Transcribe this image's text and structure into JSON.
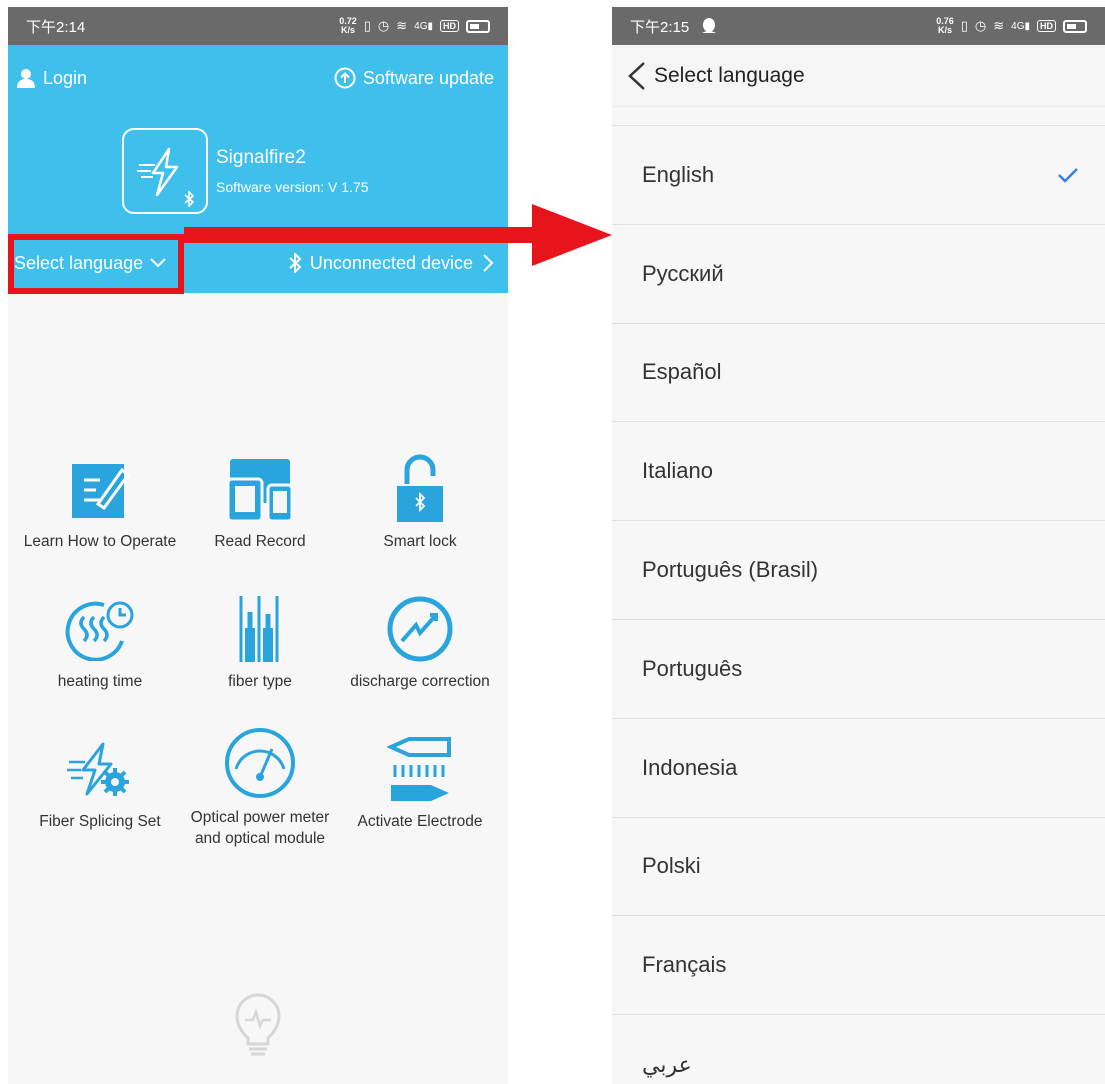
{
  "left_screen": {
    "status": {
      "time": "下午2:14",
      "speed_top": "0.72",
      "speed_bottom": "K/s",
      "network": "4G",
      "hd": "HD"
    },
    "header": {
      "login_label": "Login",
      "update_label": "Software update",
      "app_name": "Signalfire2",
      "app_version": "Software version: V 1.75",
      "select_language_label": "Select language",
      "device_label": "Unconnected device"
    },
    "menu": [
      {
        "label": "Learn How to Operate",
        "icon": "edit-document-icon"
      },
      {
        "label": "Read Record",
        "icon": "devices-icon"
      },
      {
        "label": "Smart lock",
        "icon": "lock-bluetooth-icon"
      },
      {
        "label": "heating time",
        "icon": "heating-timer-icon"
      },
      {
        "label": "fiber type",
        "icon": "fiber-type-icon"
      },
      {
        "label": "discharge correction",
        "icon": "discharge-icon"
      },
      {
        "label": "Fiber Splicing Set",
        "icon": "splicing-gear-icon"
      },
      {
        "label": "Optical power meter and optical module",
        "icon": "gauge-icon"
      },
      {
        "label": "Activate Electrode",
        "icon": "electrode-icon"
      }
    ]
  },
  "right_screen": {
    "status": {
      "time": "下午2:15",
      "speed_top": "0.76",
      "speed_bottom": "K/s",
      "network": "4G",
      "hd": "HD"
    },
    "title": "Select language",
    "languages": [
      {
        "label": "English",
        "selected": true
      },
      {
        "label": "Русский",
        "selected": false
      },
      {
        "label": "Español",
        "selected": false
      },
      {
        "label": "Italiano",
        "selected": false
      },
      {
        "label": "Português (Brasil)",
        "selected": false
      },
      {
        "label": "Português",
        "selected": false
      },
      {
        "label": "Indonesia",
        "selected": false
      },
      {
        "label": "Polski",
        "selected": false
      },
      {
        "label": "Français",
        "selected": false
      },
      {
        "label": "عربي",
        "selected": false
      }
    ]
  },
  "colors": {
    "header_blue": "#3fc0ec",
    "icon_blue": "#2aa4dc",
    "annotation_red": "#e8141b",
    "check_blue": "#3a7de0"
  }
}
